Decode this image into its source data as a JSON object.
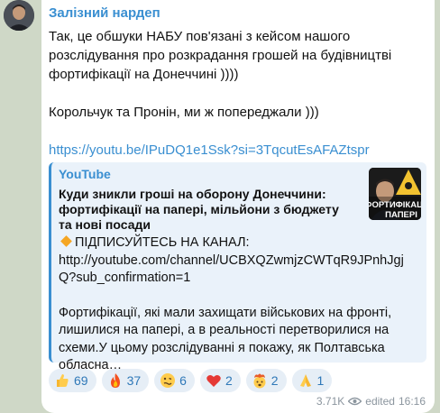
{
  "channel": {
    "name": "Залізний нардеп"
  },
  "message": {
    "para1": "Так, це обшуки НАБУ пов'язані з кейсом нашого розслідування про розкрадання грошей на будівництві фортифікації на Донеччині ))))",
    "para2": "Корольчук та Пронін, ми ж попереджали )))",
    "link": "https://youtu.be/IPuDQ1e1Ssk?si=3TqcutEsAFAZtspr"
  },
  "preview": {
    "site": "YouTube",
    "title": "Куди зникли гроші на оборону Донеччини: фортифікації на папері, мільйони з бюджету та нові посади",
    "subscribe": "ПІДПИСУЙТЕСЬ НА КАНАЛ:",
    "channel_url": "http://youtube.com/channel/UCBXQZwmjzCWTqR9JPnhJgjQ?sub_confirmation=1",
    "description": "Фортифікації, які мали захищати військових на фронті, лишилися на папері, а в реальності перетворилися на схеми.У цьому розслідуванні я покажу, як Полтавська обласна…",
    "thumb_text": "ФОРТИФІКАЦІ ПАПЕРІ"
  },
  "reactions": [
    {
      "icon": "thumbs-up-icon",
      "count": "69"
    },
    {
      "icon": "fire-icon",
      "count": "37"
    },
    {
      "icon": "woozy-face-icon",
      "count": "6"
    },
    {
      "icon": "heart-icon",
      "count": "2"
    },
    {
      "icon": "exploding-head-icon",
      "count": "2"
    },
    {
      "icon": "folded-hands-icon",
      "count": "1"
    }
  ],
  "footer": {
    "views": "3.71K",
    "edited": "edited",
    "time": "16:16"
  },
  "colors": {
    "accent": "#3a8fd1",
    "background": "#cfd8c7",
    "preview_bg": "#eaf2fa"
  }
}
